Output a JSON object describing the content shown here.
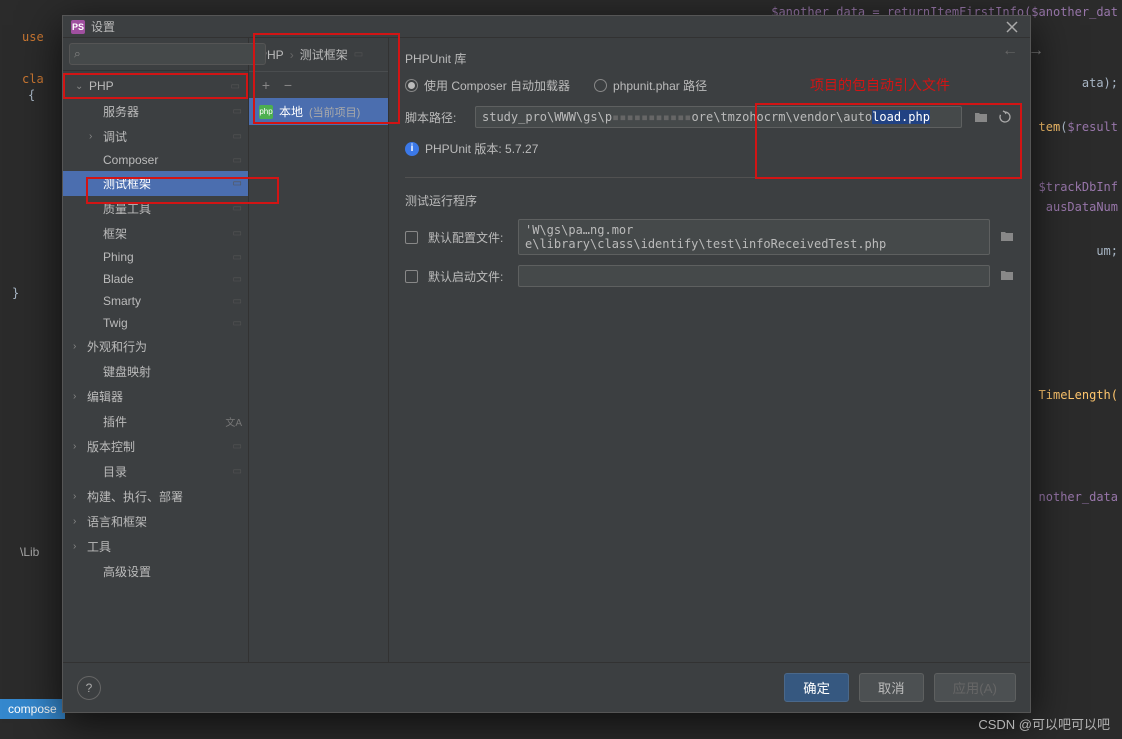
{
  "titlebar": {
    "icon": "PS",
    "title": "设置"
  },
  "search": {
    "placeholder": ""
  },
  "tree": {
    "php": "PHP",
    "items": [
      {
        "label": "服务器",
        "hasProj": true,
        "leaf": true
      },
      {
        "label": "调试",
        "hasProj": true,
        "expandable": true
      },
      {
        "label": "Composer",
        "hasProj": true,
        "leaf": true
      },
      {
        "label": "测试框架",
        "hasProj": true,
        "leaf": true,
        "selected": true
      },
      {
        "label": "质量工具",
        "hasProj": true,
        "leaf": true
      },
      {
        "label": "框架",
        "hasProj": true,
        "leaf": true
      },
      {
        "label": "Phing",
        "hasProj": true,
        "leaf": true
      },
      {
        "label": "Blade",
        "hasProj": true,
        "leaf": true
      },
      {
        "label": "Smarty",
        "hasProj": true,
        "leaf": true
      },
      {
        "label": "Twig",
        "hasProj": true,
        "leaf": true
      }
    ],
    "sections": [
      {
        "label": "外观和行为",
        "expandable": true
      },
      {
        "label": "键盘映射",
        "leaf": true
      },
      {
        "label": "编辑器",
        "expandable": true
      },
      {
        "label": "插件",
        "leaf": true,
        "langIcon": true
      },
      {
        "label": "版本控制",
        "expandable": true,
        "hasProj": true
      },
      {
        "label": "目录",
        "leaf": true,
        "hasProj": true
      },
      {
        "label": "构建、执行、部署",
        "expandable": true
      },
      {
        "label": "语言和框架",
        "expandable": true
      },
      {
        "label": "工具",
        "expandable": true
      },
      {
        "label": "高级设置",
        "leaf": true
      }
    ]
  },
  "breadcrumb": {
    "root": "PHP",
    "leaf": "测试框架"
  },
  "middle": {
    "item": "本地",
    "current": "(当前项目)"
  },
  "right": {
    "section1": "PHPUnit 库",
    "radio1": "使用 Composer 自动加载器",
    "radio2": "phpunit.phar 路径",
    "script_label": "脚本路径:",
    "script_path_prefix": "study_pro\\WWW\\gs\\p",
    "script_path_mid": "ore\\tmzohocrm\\vendor\\auto",
    "script_path_hl": "load.php",
    "version": "PHPUnit 版本: 5.7.27",
    "section2": "测试运行程序",
    "check1": "默认配置文件:",
    "check1_val": "'W\\gs\\pa…ng.mor e\\library\\class\\identify\\test\\infoReceivedTest.php",
    "check2": "默认启动文件:"
  },
  "footer": {
    "ok": "确定",
    "cancel": "取消",
    "apply": "应用(A)"
  },
  "annotations": {
    "red_text": "项目的包自动引入文件"
  },
  "bg": {
    "another": "$another_data = returnItemFirstInfo($another_dat",
    "ata": "ata);",
    "trackDbInf": "$trackDbInf",
    "ausDataNum": "ausDataNum",
    "um": "um;",
    "timeLength": "TimeLength(",
    "nother_data": "nother_data",
    "result": "tem($result",
    "use": "use",
    "cla": "cla",
    "brace": "{",
    "endbrace": "}",
    "lib": "\\Lib",
    "compose": "compose"
  },
  "watermark": "CSDN @可以吧可以吧"
}
